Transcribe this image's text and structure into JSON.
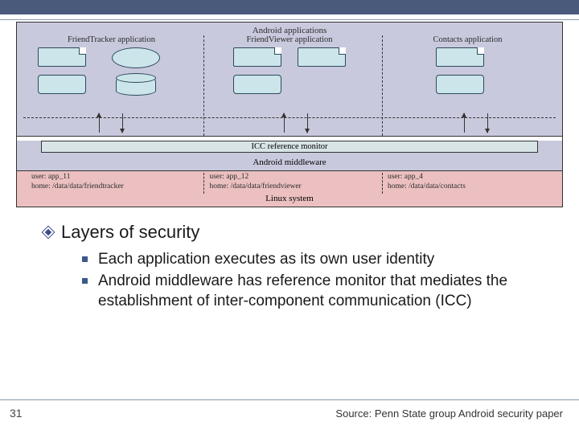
{
  "diagram": {
    "apps_title": "Android applications",
    "apps": [
      {
        "title": "FriendTracker application"
      },
      {
        "title": "FriendViewer application"
      },
      {
        "title": "Contacts application"
      }
    ],
    "icc_label": "ICC reference monitor",
    "middleware_label": "Android middleware",
    "linux": [
      {
        "user": "user: app_11",
        "home": "home: /data/data/friendtracker"
      },
      {
        "user": "user: app_12",
        "home": "home: /data/data/friendviewer"
      },
      {
        "user": "user: app_4",
        "home": "home: /data/data/contacts"
      }
    ],
    "linux_label": "Linux system"
  },
  "heading": "Layers of security",
  "bullets": [
    "Each application executes as its own user identity",
    "Android middleware has reference monitor that mediates the establishment of inter-component communication (ICC)"
  ],
  "page_number": "31",
  "source": "Source: Penn State group Android security paper"
}
